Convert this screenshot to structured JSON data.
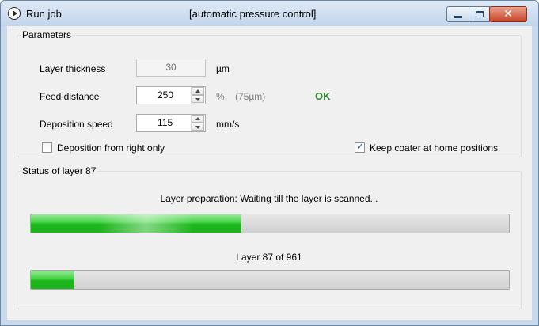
{
  "window": {
    "title": "Run job",
    "subtitle": "[automatic pressure control]",
    "icon": "play-circle-icon",
    "controls": {
      "minimize": "minimize-icon",
      "maximize": "maximize-icon",
      "close": "close-icon",
      "close_glyph": "✕"
    }
  },
  "parameters": {
    "group_label": "Parameters",
    "layer_thickness": {
      "label": "Layer thickness",
      "value": "30",
      "unit": "µm"
    },
    "feed_distance": {
      "label": "Feed distance",
      "value": "250",
      "unit": "%",
      "note": "(75µm)",
      "status": "OK"
    },
    "deposition_speed": {
      "label": "Deposition speed",
      "value": "115",
      "unit": "mm/s"
    },
    "deposition_right_only": {
      "label": "Deposition from right only",
      "checked": false
    },
    "keep_coater_home": {
      "label": "Keep coater at home positions",
      "checked": true
    }
  },
  "status": {
    "group_label": "Status of layer 87",
    "message": "Layer preparation: Waiting till the layer is scanned...",
    "layer_progress_fraction": 0.44,
    "layer_count_text": "Layer 87 of 961",
    "current_layer": 87,
    "total_layers": 961
  },
  "colors": {
    "progress_fill": "#1eb51e",
    "ok_text": "#2f8a2f",
    "close_button": "#c9442a"
  }
}
